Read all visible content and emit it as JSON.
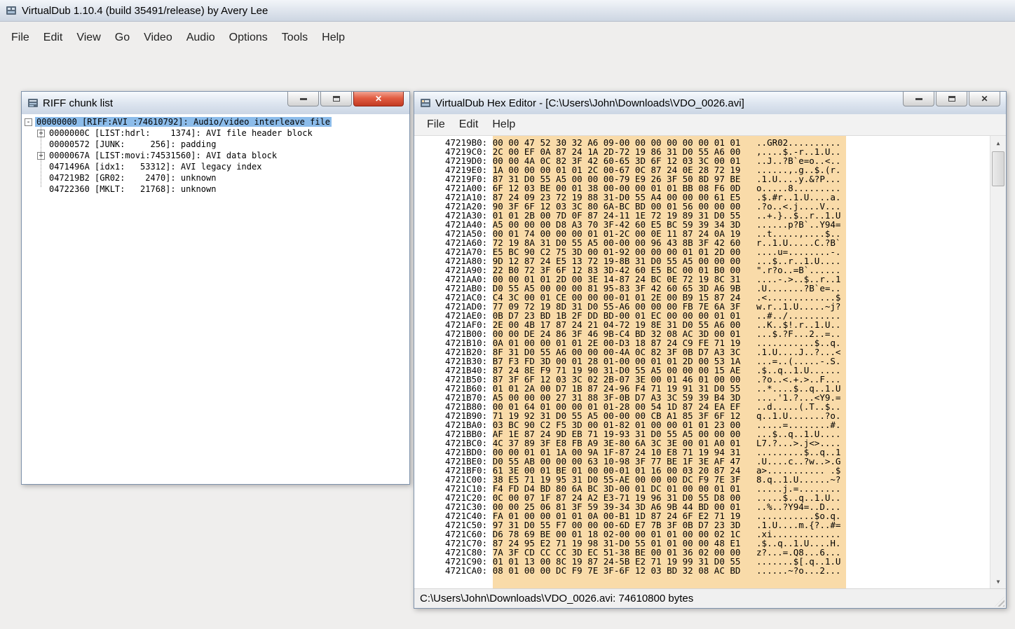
{
  "main_window": {
    "title": "VirtualDub 1.10.4 (build 35491/release) by Avery Lee",
    "menu_items": [
      "File",
      "Edit",
      "View",
      "Go",
      "Video",
      "Audio",
      "Options",
      "Tools",
      "Help"
    ]
  },
  "riff_window": {
    "title": "RIFF chunk list",
    "tree_items": [
      {
        "level": 0,
        "expander": "-",
        "label": "00000000 [RIFF:AVI :74610792]: Audio/video interleave file",
        "selected": true
      },
      {
        "level": 1,
        "expander": "+",
        "label": "0000000C [LIST:hdrl:    1374]: AVI file header block",
        "selected": false
      },
      {
        "level": 1,
        "expander": "",
        "label": "00000572 [JUNK:     256]: padding",
        "selected": false
      },
      {
        "level": 1,
        "expander": "+",
        "label": "0000067A [LIST:movi:74531560]: AVI data block",
        "selected": false
      },
      {
        "level": 1,
        "expander": "",
        "label": "0471496A [idx1:   53312]: AVI legacy index",
        "selected": false
      },
      {
        "level": 1,
        "expander": "",
        "label": "047219B2 [GR02:    2470]: unknown",
        "selected": false
      },
      {
        "level": 1,
        "expander": "",
        "label": "04722360 [MKLT:   21768]: unknown",
        "selected": false
      }
    ]
  },
  "hex_window": {
    "title": "VirtualDub Hex Editor - [C:\\Users\\John\\Downloads\\VDO_0026.avi]",
    "menu_items": [
      "File",
      "Edit",
      "Help"
    ],
    "status_text": "C:\\Users\\John\\Downloads\\VDO_0026.avi: 74610800 bytes",
    "hex_rows": [
      {
        "addr": "47219B0",
        "bytes": "00 00 47 52 30 32 A6 09-00 00 00 00 00 00 01 01",
        "ascii": "..GR02.........."
      },
      {
        "addr": "47219C0",
        "bytes": "2C 00 EF 0A 87 24 1A 2D-72 19 86 31 D0 55 A6 00",
        "ascii": ",....$.-r..1.U.."
      },
      {
        "addr": "47219D0",
        "bytes": "00 00 4A 0C 82 3F 42 60-65 3D 6F 12 03 3C 00 01",
        "ascii": "..J..?B`e=o..<.."
      },
      {
        "addr": "47219E0",
        "bytes": "1A 00 00 00 01 01 2C 00-67 0C 87 24 0E 28 72 19",
        "ascii": "......,.g..$.(r."
      },
      {
        "addr": "47219F0",
        "bytes": "87 31 D0 55 A5 00 00 00-79 E9 26 3F 50 8D 97 BE",
        "ascii": ".1.U....y.&?P..."
      },
      {
        "addr": "4721A00",
        "bytes": "6F 12 03 BE 00 01 38 00-00 00 01 01 BB 08 F6 0D",
        "ascii": "o.....8........."
      },
      {
        "addr": "4721A10",
        "bytes": "87 24 09 23 72 19 88 31-D0 55 A4 00 00 00 61 E5",
        "ascii": ".$.#r..1.U....a."
      },
      {
        "addr": "4721A20",
        "bytes": "90 3F 6F 12 03 3C 80 6A-BC BD 00 01 56 00 00 00",
        "ascii": ".?o..<.j....V..."
      },
      {
        "addr": "4721A30",
        "bytes": "01 01 2B 00 7D 0F 87 24-11 1E 72 19 89 31 D0 55",
        "ascii": "..+.}..$..r..1.U"
      },
      {
        "addr": "4721A40",
        "bytes": "A5 00 00 00 D8 A3 70 3F-42 60 E5 BC 59 39 34 3D",
        "ascii": "......p?B`..Y94="
      },
      {
        "addr": "4721A50",
        "bytes": "00 01 74 00 00 00 01 01-2C 00 0E 11 87 24 0A 19",
        "ascii": "..t.....,....$.."
      },
      {
        "addr": "4721A60",
        "bytes": "72 19 8A 31 D0 55 A5 00-00 00 96 43 8B 3F 42 60",
        "ascii": "r..1.U.....C.?B`"
      },
      {
        "addr": "4721A70",
        "bytes": "E5 BC 90 C2 75 3D 00 01-92 00 00 00 01 01 2D 00",
        "ascii": "....u=........-."
      },
      {
        "addr": "4721A80",
        "bytes": "9D 12 87 24 E5 13 72 19-8B 31 D0 55 A5 00 00 00",
        "ascii": "...$..r..1.U...."
      },
      {
        "addr": "4721A90",
        "bytes": "22 B0 72 3F 6F 12 83 3D-42 60 E5 BC 00 01 B0 00",
        "ascii": "\".r?o..=B`......"
      },
      {
        "addr": "4721AA0",
        "bytes": "00 00 01 01 2D 00 3E 14-87 24 BC 0E 72 19 8C 31",
        "ascii": "....-.>..$..r..1"
      },
      {
        "addr": "4721AB0",
        "bytes": "D0 55 A5 00 00 00 81 95-83 3F 42 60 65 3D A6 9B",
        "ascii": ".U.......?B`e=.."
      },
      {
        "addr": "4721AC0",
        "bytes": "C4 3C 00 01 CE 00 00 00-01 01 2E 00 B9 15 87 24",
        "ascii": ".<.............$"
      },
      {
        "addr": "4721AD0",
        "bytes": "77 09 72 19 8D 31 D0 55-A6 00 00 00 FB 7E 6A 3F",
        "ascii": "w.r..1.U.....~j?"
      },
      {
        "addr": "4721AE0",
        "bytes": "0B D7 23 BD 1B 2F DD BD-00 01 EC 00 00 00 01 01",
        "ascii": "..#../.........."
      },
      {
        "addr": "4721AF0",
        "bytes": "2E 00 4B 17 87 24 21 04-72 19 8E 31 D0 55 A6 00",
        "ascii": "..K..$!.r..1.U.."
      },
      {
        "addr": "4721B00",
        "bytes": "00 00 DE 24 86 3F 46 9B-C4 BD 32 08 AC 3D 00 01",
        "ascii": "...$.?F...2..=.."
      },
      {
        "addr": "4721B10",
        "bytes": "0A 01 00 00 01 01 2E 00-D3 18 87 24 C9 FE 71 19",
        "ascii": "...........$..q."
      },
      {
        "addr": "4721B20",
        "bytes": "8F 31 D0 55 A6 00 00 00-4A 0C 82 3F 0B D7 A3 3C",
        "ascii": ".1.U....J..?...<"
      },
      {
        "addr": "4721B30",
        "bytes": "B7 F3 FD 3D 00 01 28 01-00 00 01 01 2D 00 53 1A",
        "ascii": "...=..(.....-.S."
      },
      {
        "addr": "4721B40",
        "bytes": "87 24 8E F9 71 19 90 31-D0 55 A5 00 00 00 15 AE",
        "ascii": ".$..q..1.U......"
      },
      {
        "addr": "4721B50",
        "bytes": "87 3F 6F 12 03 3C 02 2B-07 3E 00 01 46 01 00 00",
        "ascii": ".?o..<.+.>..F..."
      },
      {
        "addr": "4721B60",
        "bytes": "01 01 2A 00 D7 1B 87 24-96 F4 71 19 91 31 D0 55",
        "ascii": "..*....$..q..1.U"
      },
      {
        "addr": "4721B70",
        "bytes": "A5 00 00 00 27 31 88 3F-0B D7 A3 3C 59 39 B4 3D",
        "ascii": "....'1.?...<Y9.="
      },
      {
        "addr": "4721B80",
        "bytes": "00 01 64 01 00 00 01 01-28 00 54 1D 87 24 EA EF",
        "ascii": "..d.....(.T..$.."
      },
      {
        "addr": "4721B90",
        "bytes": "71 19 92 31 D0 55 A5 00-00 00 CB A1 85 3F 6F 12",
        "ascii": "q..1.U.......?o."
      },
      {
        "addr": "4721BA0",
        "bytes": "03 BC 90 C2 F5 3D 00 01-82 01 00 00 01 01 23 00",
        "ascii": ".....=........#."
      },
      {
        "addr": "4721BB0",
        "bytes": "AF 1E 87 24 9D EB 71 19-93 31 D0 55 A5 00 00 00",
        "ascii": "...$..q..1.U...."
      },
      {
        "addr": "4721BC0",
        "bytes": "4C 37 89 3F E8 FB A9 3E-80 6A 3C 3E 00 01 A0 01",
        "ascii": "L7.?...>.j<>...."
      },
      {
        "addr": "4721BD0",
        "bytes": "00 00 01 01 1A 00 9A 1F-87 24 10 E8 71 19 94 31",
        "ascii": ".........$..q..1"
      },
      {
        "addr": "4721BE0",
        "bytes": "D0 55 AB 00 00 00 63 10-98 3F 77 BE 1F 3E AF 47",
        "ascii": ".U....c..?w..>.G"
      },
      {
        "addr": "4721BF0",
        "bytes": "61 3E 00 01 BE 01 00 00-01 01 16 00 03 20 87 24",
        "ascii": "a>........... .$"
      },
      {
        "addr": "4721C00",
        "bytes": "38 E5 71 19 95 31 D0 55-AE 00 00 00 DC F9 7E 3F",
        "ascii": "8.q..1.U......~?"
      },
      {
        "addr": "4721C10",
        "bytes": "F4 FD D4 BD 80 6A BC 3D-00 01 DC 01 00 00 01 01",
        "ascii": ".....j.=........"
      },
      {
        "addr": "4721C20",
        "bytes": "0C 00 07 1F 87 24 A2 E3-71 19 96 31 D0 55 D8 00",
        "ascii": ".....$..q..1.U.."
      },
      {
        "addr": "4721C30",
        "bytes": "00 00 25 06 81 3F 59 39-34 3D A6 9B 44 BD 00 01",
        "ascii": "..%..?Y94=..D..."
      },
      {
        "addr": "4721C40",
        "bytes": "FA 01 00 00 01 01 0A 00-B1 1D 87 24 6F E2 71 19",
        "ascii": "...........$o.q."
      },
      {
        "addr": "4721C50",
        "bytes": "97 31 D0 55 F7 00 00 00-6D E7 7B 3F 0B D7 23 3D",
        "ascii": ".1.U....m.{?..#="
      },
      {
        "addr": "4721C60",
        "bytes": "D6 78 69 BE 00 01 18 02-00 00 01 01 00 00 02 1C",
        "ascii": ".xi............."
      },
      {
        "addr": "4721C70",
        "bytes": "87 24 95 E2 71 19 98 31-D0 55 01 01 00 00 48 E1",
        "ascii": ".$..q..1.U....H."
      },
      {
        "addr": "4721C80",
        "bytes": "7A 3F CD CC CC 3D EC 51-38 BE 00 01 36 02 00 00",
        "ascii": "z?...=.Q8...6..."
      },
      {
        "addr": "4721C90",
        "bytes": "01 01 13 00 8C 19 87 24-5B E2 71 19 99 31 D0 55",
        "ascii": ".......$[.q..1.U"
      },
      {
        "addr": "4721CA0",
        "bytes": "08 01 00 00 DC F9 7E 3F-6F 12 03 BD 32 08 AC BD",
        "ascii": "......~?o...2..."
      }
    ]
  }
}
